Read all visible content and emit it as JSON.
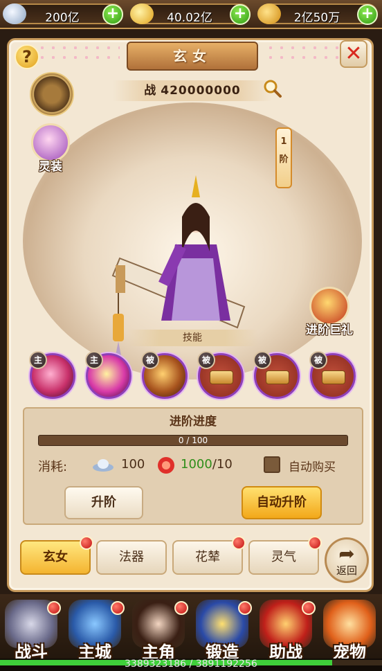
{
  "currencies": [
    {
      "icon": "silver-ingot-icon",
      "value": "200亿"
    },
    {
      "icon": "gold-ingot-icon",
      "value": "40.02亿"
    },
    {
      "icon": "bound-gold-icon",
      "value": "2亿50万"
    }
  ],
  "title": "玄女",
  "power": {
    "label": "战",
    "value": "420000000"
  },
  "side": {
    "lingzhuang": "灵装",
    "gift": "进阶巨礼"
  },
  "rank": {
    "num": "1",
    "unit": "阶"
  },
  "skill_section": "技能",
  "skills": [
    {
      "tag": "主",
      "locked": false,
      "color": "#c8306a"
    },
    {
      "tag": "主",
      "locked": false,
      "color": "#b83aa8"
    },
    {
      "tag": "被",
      "locked": false,
      "color": "#a8541e"
    },
    {
      "tag": "被",
      "locked": true,
      "color": "#a63a2a"
    },
    {
      "tag": "被",
      "locked": true,
      "color": "#a63a2a"
    },
    {
      "tag": "被",
      "locked": true,
      "color": "#a63a2a"
    }
  ],
  "advance": {
    "title": "进阶进度",
    "progress_text": "0 / 100",
    "progress": 0,
    "cost_label": "消耗:",
    "silver_cost": "100",
    "item_have": "1000",
    "item_need": "/10",
    "auto_buy": "自动购买",
    "upgrade_btn": "升阶",
    "auto_upgrade_btn": "自动升阶"
  },
  "tabs": [
    "玄女",
    "法器",
    "花辇",
    "灵气"
  ],
  "back": "返回",
  "nav": [
    "战斗",
    "主城",
    "主角",
    "锻造",
    "助战",
    "宠物"
  ],
  "footer": {
    "text": "3389323186 / 3891192256",
    "progress": 0.87
  }
}
